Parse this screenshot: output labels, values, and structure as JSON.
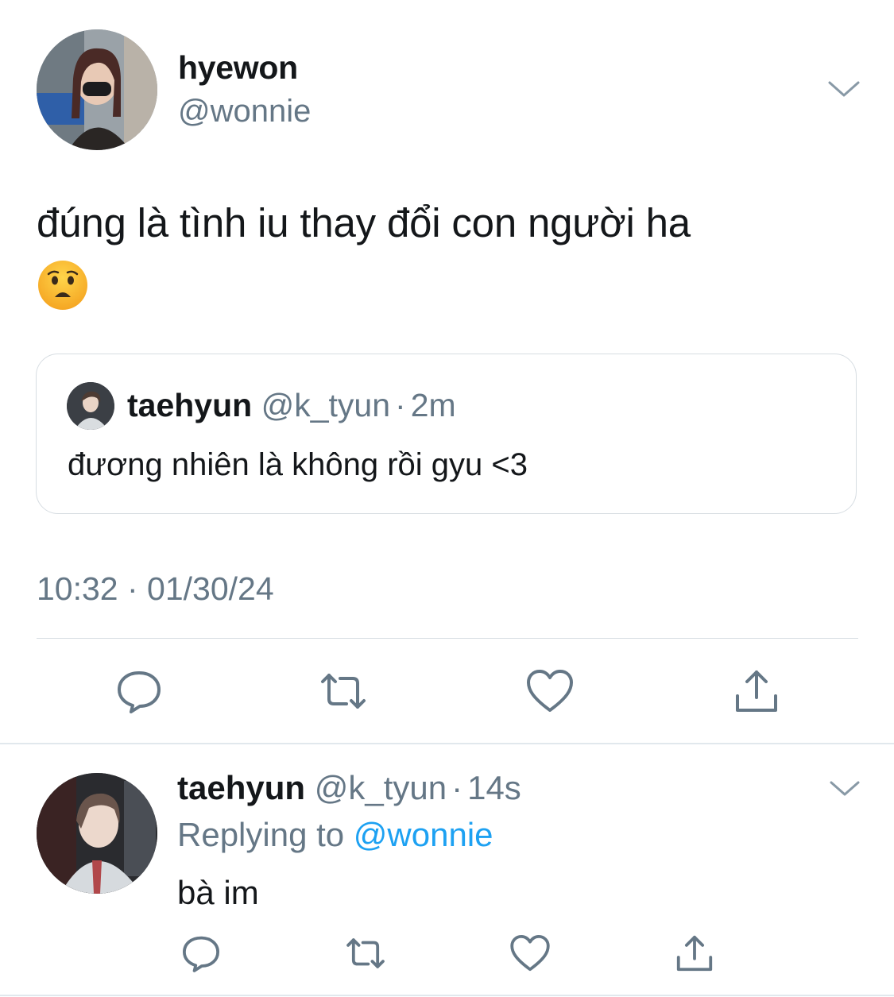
{
  "main_tweet": {
    "author_name": "hyewon",
    "author_handle": "@wonnie",
    "text": "đúng là tình iu thay đổi con người ha",
    "emoji": "anguished-face",
    "timestamp": "10:32 · 01/30/24"
  },
  "quoted_tweet": {
    "author_name": "taehyun",
    "author_handle": "@k_tyun",
    "separator": "·",
    "time": "2m",
    "text": "đương nhiên là không rồi gyu <3"
  },
  "actions": [
    "reply-icon",
    "retweet-icon",
    "like-icon",
    "share-icon"
  ],
  "reply": {
    "author_name": "taehyun",
    "author_handle": "@k_tyun",
    "separator": "·",
    "time": "14s",
    "replying_prefix": "Replying to",
    "replying_to": "@wonnie",
    "text": "bà im"
  },
  "colors": {
    "text": "#14171a",
    "secondary": "#657786",
    "accent": "#1da1f2",
    "border": "#d7dde2"
  }
}
